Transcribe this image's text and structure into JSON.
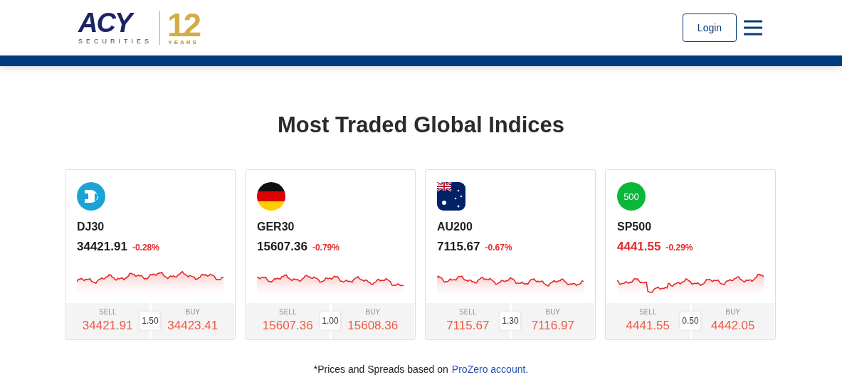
{
  "header": {
    "logo": {
      "wordmark": "ACY",
      "tagline": "SECURITIES",
      "anniversary_number": "12",
      "anniversary_word": "YEARS"
    },
    "login_button": "Login"
  },
  "title": "Most Traded Global Indices",
  "cards": [
    {
      "kind": "dj",
      "symbol": "DJ30",
      "price": "34421.91",
      "price_highlight": false,
      "change": "-0.28%",
      "sell_label": "SELL",
      "sell": "34421.91",
      "spread": "1.50",
      "buy_label": "BUY",
      "buy": "34423.41"
    },
    {
      "kind": "flag-de",
      "symbol": "GER30",
      "price": "15607.36",
      "price_highlight": false,
      "change": "-0.79%",
      "sell_label": "SELL",
      "sell": "15607.36",
      "spread": "1.00",
      "buy_label": "BUY",
      "buy": "15608.36"
    },
    {
      "kind": "flag-au",
      "symbol": "AU200",
      "price": "7115.67",
      "price_highlight": false,
      "change": "-0.67%",
      "sell_label": "SELL",
      "sell": "7115.67",
      "spread": "1.30",
      "buy_label": "BUY",
      "buy": "7116.97"
    },
    {
      "kind": "badge",
      "badge_text": "500",
      "symbol": "SP500",
      "price": "4441.55",
      "price_highlight": true,
      "change": "-0.29%",
      "sell_label": "SELL",
      "sell": "4441.55",
      "spread": "0.50",
      "buy_label": "BUY",
      "buy": "4442.05"
    }
  ],
  "footnote": {
    "text": "*Prices and Spreads based on",
    "link": "ProZero account."
  }
}
